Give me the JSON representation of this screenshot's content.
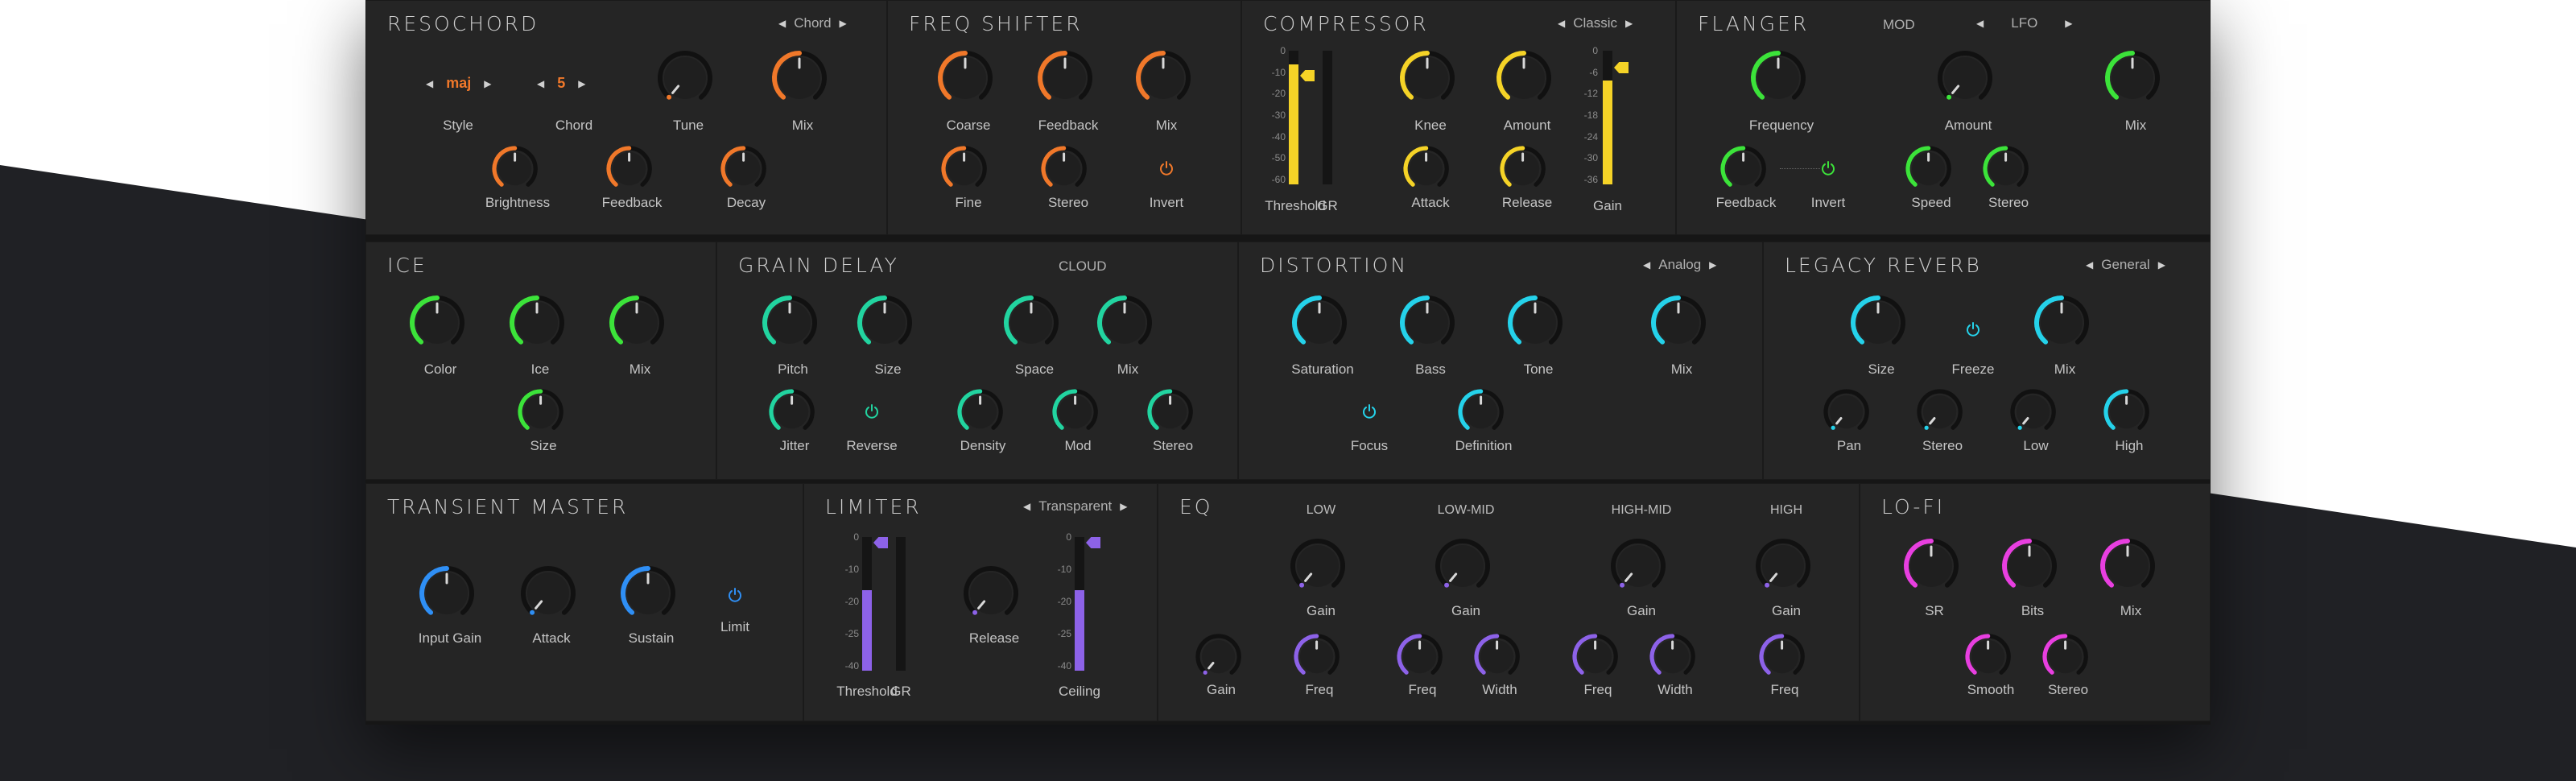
{
  "colors": {
    "background_dark": "#202125",
    "panel": "#252525",
    "orange": "#f0782a",
    "yellow": "#f5d327",
    "green": "#3ce33a",
    "teal": "#22d4a0",
    "cyan": "#25d2ea",
    "blue": "#2f8ff5",
    "purple": "#8d62e8",
    "pink": "#e83fe0"
  },
  "resochord": {
    "title": "RESOCHORD",
    "preset": "Chord",
    "style_value": "maj",
    "chord_value": "5",
    "labels": [
      "Style",
      "Chord",
      "Tune",
      "Mix",
      "Brightness",
      "Feedback",
      "Decay"
    ]
  },
  "freq_shifter": {
    "title": "FREQ SHIFTER",
    "labels": [
      "Coarse",
      "Feedback",
      "Mix",
      "Fine",
      "Stereo",
      "Invert"
    ]
  },
  "compressor": {
    "title": "COMPRESSOR",
    "preset": "Classic",
    "labels": [
      "Threshold",
      "GR",
      "Knee",
      "Amount",
      "Attack",
      "Release",
      "Gain"
    ],
    "scale_left": [
      "0",
      "-10",
      "-20",
      "-30",
      "-40",
      "-50",
      "-60"
    ],
    "scale_right": [
      "0",
      "-6",
      "-12",
      "-18",
      "-24",
      "-30",
      "-36"
    ],
    "threshold_level": 0.9,
    "gain_level": 0.78
  },
  "flanger": {
    "title": "FLANGER",
    "mod_label": "MOD",
    "mod_value": "LFO",
    "labels": [
      "Frequency",
      "Amount",
      "Mix",
      "Feedback",
      "Invert",
      "Speed",
      "Stereo"
    ]
  },
  "ice": {
    "title": "ICE",
    "labels": [
      "Color",
      "Ice",
      "Mix",
      "Size"
    ]
  },
  "grain_delay": {
    "title": "GRAIN DELAY",
    "mode": "CLOUD",
    "labels": [
      "Pitch",
      "Size",
      "Space",
      "Mix",
      "Jitter",
      "Reverse",
      "Density",
      "Mod",
      "Stereo"
    ]
  },
  "distortion": {
    "title": "DISTORTION",
    "preset": "Analog",
    "labels": [
      "Saturation",
      "Bass",
      "Tone",
      "Mix",
      "Focus",
      "Definition"
    ]
  },
  "legacy_reverb": {
    "title": "LEGACY REVERB",
    "preset": "General",
    "labels": [
      "Size",
      "Freeze",
      "Mix",
      "Pan",
      "Stereo",
      "Low",
      "High"
    ]
  },
  "transient_master": {
    "title": "TRANSIENT MASTER",
    "labels": [
      "Input Gain",
      "Attack",
      "Sustain",
      "Limit"
    ]
  },
  "limiter": {
    "title": "LIMITER",
    "preset": "Transparent",
    "labels": [
      "Threshold",
      "GR",
      "Release",
      "Ceiling"
    ],
    "scale": [
      "0",
      "-10",
      "-20",
      "-25",
      "-40"
    ],
    "threshold_level": 0.6,
    "ceiling_level": 0.6
  },
  "eq": {
    "title": "EQ",
    "bands": [
      "LOW",
      "LOW-MID",
      "HIGH-MID",
      "HIGH"
    ],
    "labels": [
      "Gain",
      "Gain",
      "Gain",
      "Gain",
      "Gain",
      "Freq",
      "Freq",
      "Width",
      "Freq",
      "Width",
      "Freq"
    ]
  },
  "lofi": {
    "title": "LO-FI",
    "labels": [
      "SR",
      "Bits",
      "Mix",
      "Smooth",
      "Stereo"
    ]
  }
}
